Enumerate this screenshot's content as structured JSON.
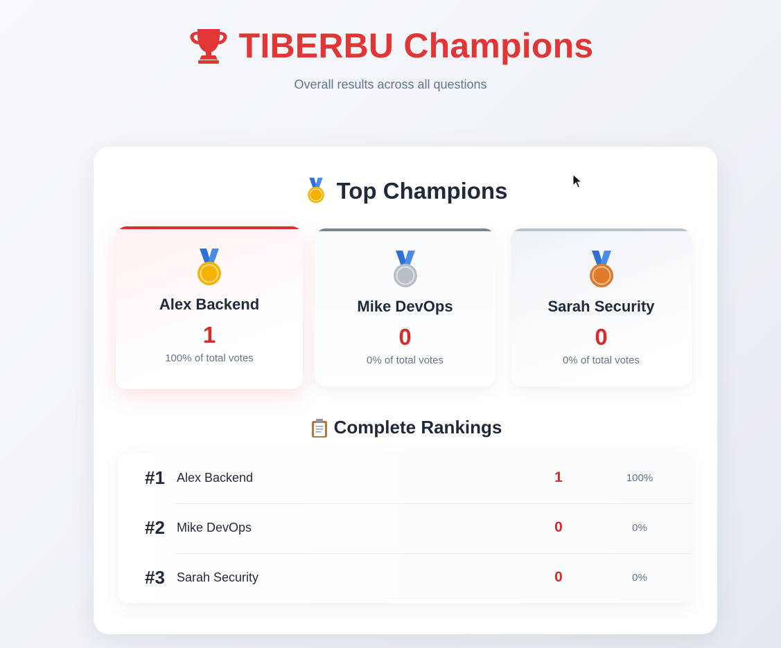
{
  "header": {
    "title": "TIBERBU Champions",
    "subtitle": "Overall results across all questions",
    "icon": "trophy-icon",
    "accent_color": "#e23636"
  },
  "top_champions": {
    "title": "Top Champions",
    "icon": "gold-medal-icon",
    "entries": [
      {
        "place": 1,
        "medal": "gold-medal-icon",
        "name": "Alex Backend",
        "votes": "1",
        "percent_label": "100% of total votes"
      },
      {
        "place": 2,
        "medal": "silver-medal-icon",
        "name": "Mike DevOps",
        "votes": "0",
        "percent_label": "0% of total votes"
      },
      {
        "place": 3,
        "medal": "bronze-medal-icon",
        "name": "Sarah Security",
        "votes": "0",
        "percent_label": "0% of total votes"
      }
    ]
  },
  "rankings": {
    "title": "Complete Rankings",
    "icon": "clipboard-icon",
    "rows": [
      {
        "rank": "#1",
        "name": "Alex Backend",
        "votes": "1",
        "percent": "100%"
      },
      {
        "rank": "#2",
        "name": "Mike DevOps",
        "votes": "0",
        "percent": "0%"
      },
      {
        "rank": "#3",
        "name": "Sarah Security",
        "votes": "0",
        "percent": "0%"
      }
    ]
  },
  "colors": {
    "vote_color": "#d92b2b",
    "first_bar": "#d93030",
    "second_bar": "#7b8494",
    "third_bar": "#bcc2cc"
  }
}
